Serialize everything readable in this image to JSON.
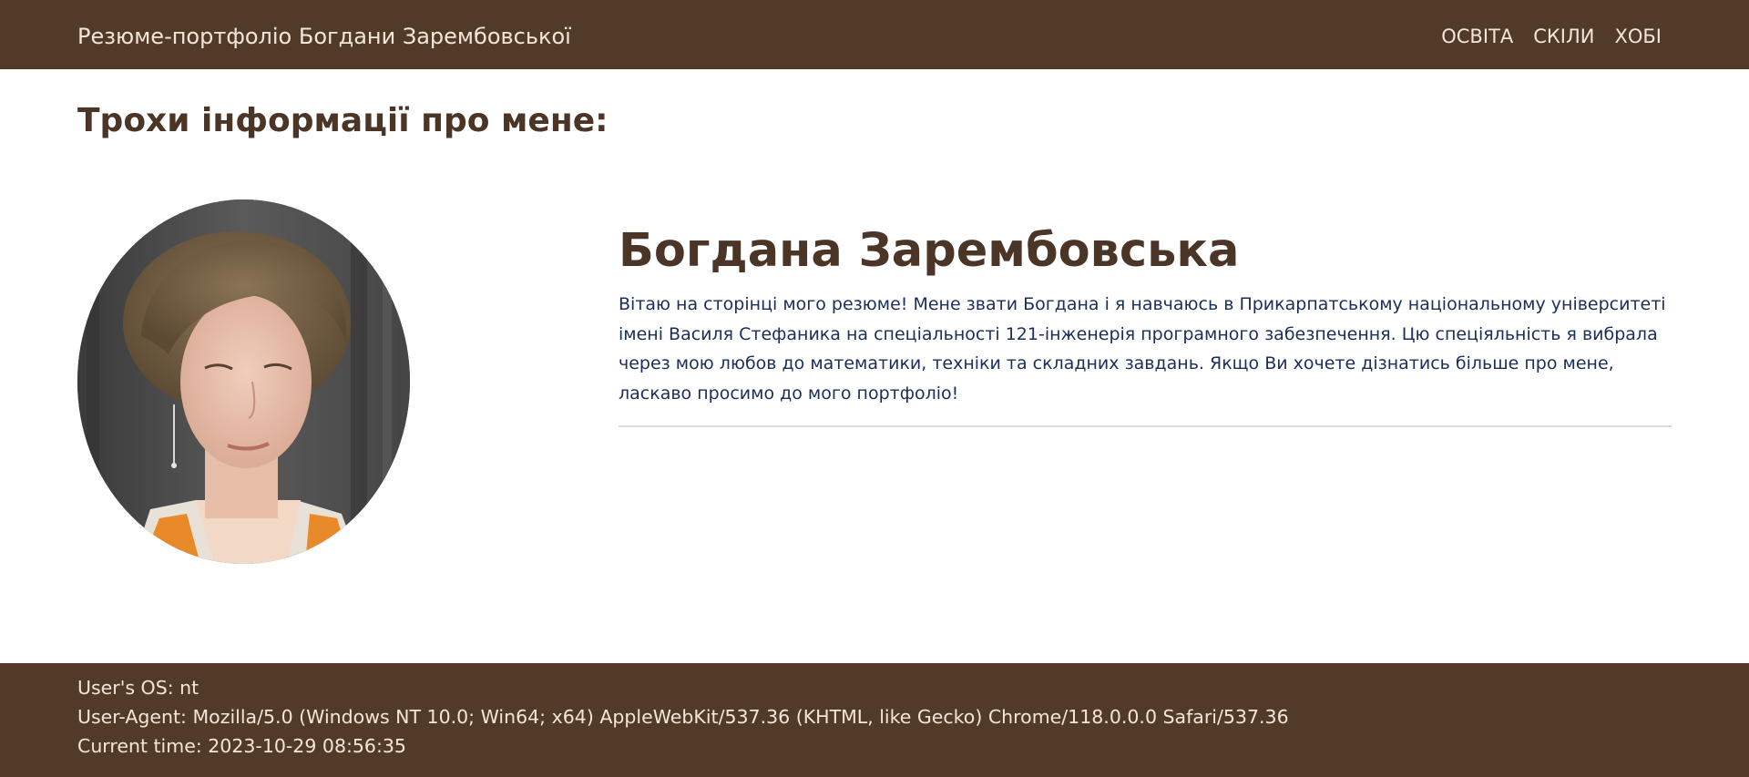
{
  "navbar": {
    "brand": "Резюме-портфоліо Богдани Зарембовської",
    "links": [
      "ОСВІТА",
      "СКІЛИ",
      "ХОБІ"
    ],
    "background_color": "#523a28"
  },
  "main": {
    "section_heading": "Трохи інформації про мене:",
    "name": "Богдана Зарембовська",
    "bio": "Вітаю на сторінці мого резюме! Мене звати Богдана і я навчаюсь в Прикарпатському національному університеті імені Василя Стефаника на спеціальності 121-інженерія програмного забезпечення. Цю спеціяльність я вибрала через мою любов до математики, техніки та складних завдань. Якщо Ви хочете дізнатись більше про мене, ласкаво просимо до мого портфоліо!",
    "photo_icon": "profile-photo"
  },
  "footer": {
    "os_line": "User's OS: nt",
    "user_agent_line": "User-Agent: Mozilla/5.0 (Windows NT 10.0; Win64; x64) AppleWebKit/537.36 (KHTML, like Gecko) Chrome/118.0.0.0 Safari/537.36",
    "time_line": "Current time: 2023-10-29 08:56:35"
  }
}
